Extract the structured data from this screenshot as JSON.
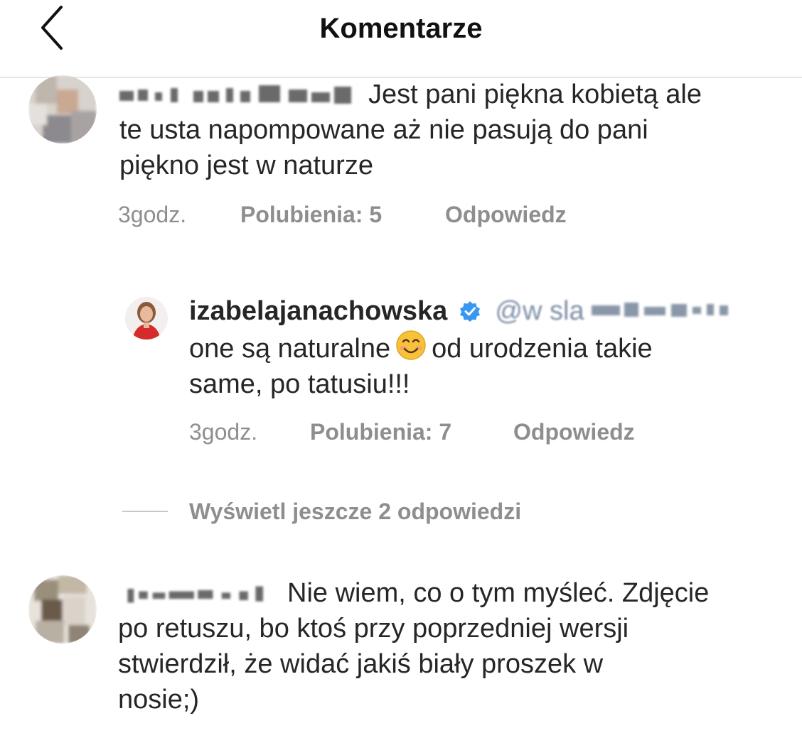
{
  "header": {
    "title": "Komentarze",
    "back_icon": "chevron-left-icon"
  },
  "comments": [
    {
      "text_lines": [
        "Jest pani piękna kobietą ale",
        "te usta napompowane aż nie pasują do pani",
        "piękno jest w naturze"
      ],
      "time": "3godz.",
      "likes": "Polubienia: 5",
      "reply": "Odpowiedz"
    },
    {
      "username": "izabelajanachowska",
      "verified_icon": "verified-badge-icon",
      "mention": "@w   sla",
      "text_line1_a": "one są naturalne",
      "emoji_icon": "smiling-face-emoji-icon",
      "text_line1_b": "od urodzenia takie",
      "text_line2": "same, po tatusiu!!!",
      "time": "3godz.",
      "likes": "Polubienia: 7",
      "reply": "Odpowiedz"
    },
    {
      "text_lines": [
        "Nie wiem, co o tym myśleć. Zdjęcie",
        "po retuszu, bo ktoś przy poprzedniej wersji",
        "stwierdził, że widać jakiś biały proszek w",
        "nosie;)"
      ]
    }
  ],
  "view_more_replies": "Wyświetl jeszcze 2 odpowiedzi"
}
